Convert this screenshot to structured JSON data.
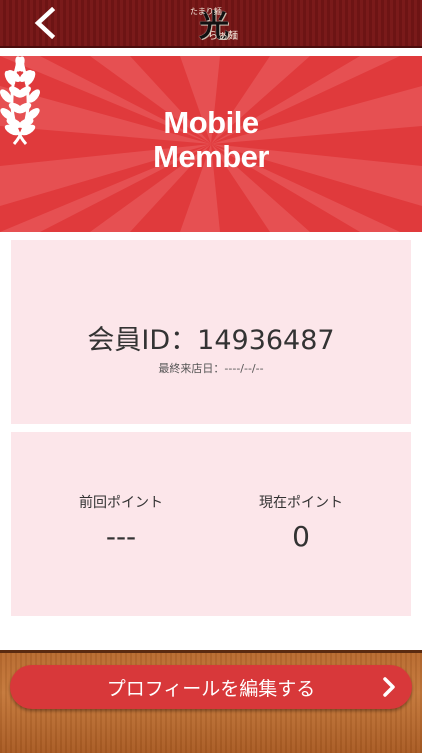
{
  "header": {
    "logo_main": "光",
    "logo_small_top": "たまり麺",
    "logo_small_right": "の",
    "logo_small_suffix": "らぁ麺"
  },
  "banner": {
    "line1": "Mobile",
    "line2": "Member"
  },
  "member": {
    "id_text": "会員ID：14936487",
    "last_visit": "最終来店日：----/--/--"
  },
  "points": {
    "previous_label": "前回ポイント",
    "previous_value": "---",
    "current_label": "現在ポイント",
    "current_value": "0"
  },
  "footer": {
    "edit_profile_label": "プロフィールを編集する"
  },
  "icons": {
    "back": "chevron-left-icon",
    "laurel_left": "laurel-icon",
    "laurel_right": "laurel-icon",
    "next": "chevron-right-icon"
  },
  "colors": {
    "banner_red": "#e03a3c",
    "card_pink": "#fce6ea",
    "button_red": "#d8383a",
    "header_maroon": "#741818"
  }
}
